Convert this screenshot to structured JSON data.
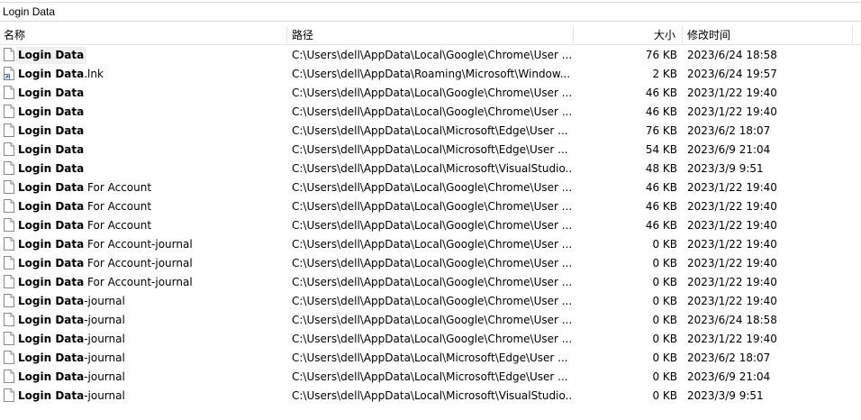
{
  "search": {
    "value": "Login Data"
  },
  "columns": {
    "name": "名称",
    "path": "路径",
    "size": "大小",
    "modified": "修改时间"
  },
  "rows": [
    {
      "name_match": "Login Data",
      "name_rest": "",
      "icon": "file-icon",
      "path": "C:\\Users\\dell\\AppData\\Local\\Google\\Chrome\\User ...",
      "size": "76 KB",
      "modified": "2023/6/24 18:58",
      "selected": true
    },
    {
      "name_match": "Login Data",
      "name_rest": ".lnk",
      "icon": "shortcut-icon",
      "path": "C:\\Users\\dell\\AppData\\Roaming\\Microsoft\\Window...",
      "size": "2 KB",
      "modified": "2023/6/24 19:57"
    },
    {
      "name_match": "Login Data",
      "name_rest": "",
      "icon": "file-icon",
      "path": "C:\\Users\\dell\\AppData\\Local\\Google\\Chrome\\User ...",
      "size": "46 KB",
      "modified": "2023/1/22 19:40"
    },
    {
      "name_match": "Login Data",
      "name_rest": "",
      "icon": "file-icon",
      "path": "C:\\Users\\dell\\AppData\\Local\\Google\\Chrome\\User ...",
      "size": "46 KB",
      "modified": "2023/1/22 19:40"
    },
    {
      "name_match": "Login Data",
      "name_rest": "",
      "icon": "file-icon",
      "path": "C:\\Users\\dell\\AppData\\Local\\Microsoft\\Edge\\User ...",
      "size": "76 KB",
      "modified": "2023/6/2 18:07"
    },
    {
      "name_match": "Login Data",
      "name_rest": "",
      "icon": "file-icon",
      "path": "C:\\Users\\dell\\AppData\\Local\\Microsoft\\Edge\\User ...",
      "size": "54 KB",
      "modified": "2023/6/9 21:04"
    },
    {
      "name_match": "Login Data",
      "name_rest": "",
      "icon": "file-icon",
      "path": "C:\\Users\\dell\\AppData\\Local\\Microsoft\\VisualStudio...",
      "size": "48 KB",
      "modified": "2023/3/9 9:51"
    },
    {
      "name_match": "Login Data",
      "name_rest": " For Account",
      "icon": "file-icon",
      "path": "C:\\Users\\dell\\AppData\\Local\\Google\\Chrome\\User ...",
      "size": "46 KB",
      "modified": "2023/1/22 19:40"
    },
    {
      "name_match": "Login Data",
      "name_rest": " For Account",
      "icon": "file-icon",
      "path": "C:\\Users\\dell\\AppData\\Local\\Google\\Chrome\\User ...",
      "size": "46 KB",
      "modified": "2023/1/22 19:40"
    },
    {
      "name_match": "Login Data",
      "name_rest": " For Account",
      "icon": "file-icon",
      "path": "C:\\Users\\dell\\AppData\\Local\\Google\\Chrome\\User ...",
      "size": "46 KB",
      "modified": "2023/1/22 19:40"
    },
    {
      "name_match": "Login Data",
      "name_rest": " For Account-journal",
      "icon": "file-icon",
      "path": "C:\\Users\\dell\\AppData\\Local\\Google\\Chrome\\User ...",
      "size": "0 KB",
      "modified": "2023/1/22 19:40"
    },
    {
      "name_match": "Login Data",
      "name_rest": " For Account-journal",
      "icon": "file-icon",
      "path": "C:\\Users\\dell\\AppData\\Local\\Google\\Chrome\\User ...",
      "size": "0 KB",
      "modified": "2023/1/22 19:40"
    },
    {
      "name_match": "Login Data",
      "name_rest": " For Account-journal",
      "icon": "file-icon",
      "path": "C:\\Users\\dell\\AppData\\Local\\Google\\Chrome\\User ...",
      "size": "0 KB",
      "modified": "2023/1/22 19:40"
    },
    {
      "name_match": "Login Data",
      "name_rest": "-journal",
      "icon": "file-icon",
      "path": "C:\\Users\\dell\\AppData\\Local\\Google\\Chrome\\User ...",
      "size": "0 KB",
      "modified": "2023/1/22 19:40"
    },
    {
      "name_match": "Login Data",
      "name_rest": "-journal",
      "icon": "file-icon",
      "path": "C:\\Users\\dell\\AppData\\Local\\Google\\Chrome\\User ...",
      "size": "0 KB",
      "modified": "2023/6/24 18:58"
    },
    {
      "name_match": "Login Data",
      "name_rest": "-journal",
      "icon": "file-icon",
      "path": "C:\\Users\\dell\\AppData\\Local\\Google\\Chrome\\User ...",
      "size": "0 KB",
      "modified": "2023/1/22 19:40"
    },
    {
      "name_match": "Login Data",
      "name_rest": "-journal",
      "icon": "file-icon",
      "path": "C:\\Users\\dell\\AppData\\Local\\Microsoft\\Edge\\User ...",
      "size": "0 KB",
      "modified": "2023/6/2 18:07"
    },
    {
      "name_match": "Login Data",
      "name_rest": "-journal",
      "icon": "file-icon",
      "path": "C:\\Users\\dell\\AppData\\Local\\Microsoft\\Edge\\User ...",
      "size": "0 KB",
      "modified": "2023/6/9 21:04"
    },
    {
      "name_match": "Login Data",
      "name_rest": "-journal",
      "icon": "file-icon",
      "path": "C:\\Users\\dell\\AppData\\Local\\Microsoft\\VisualStudio...",
      "size": "0 KB",
      "modified": "2023/3/9 9:51"
    }
  ]
}
